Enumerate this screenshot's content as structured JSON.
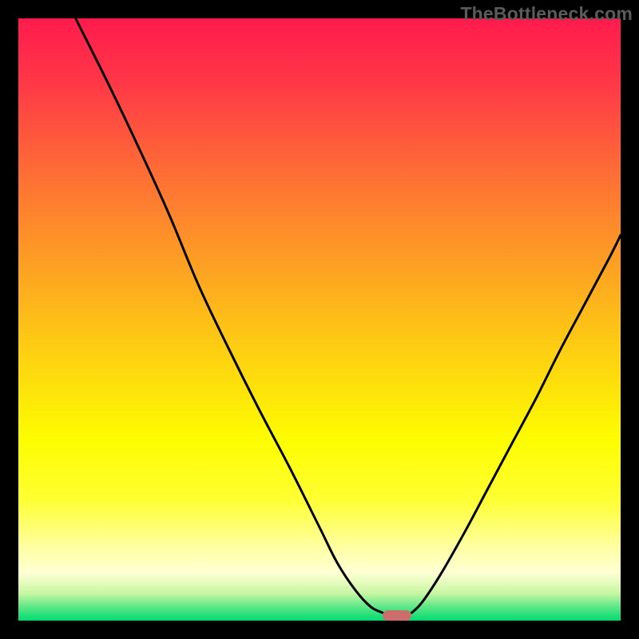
{
  "watermark": "TheBottleneck.com",
  "colors": {
    "frame": "#000000",
    "watermark": "#5b5b5b",
    "curve": "#000000",
    "marker": "#cb6e6c",
    "gradient_stops": [
      {
        "offset": 0.0,
        "color": "#ff1b4d"
      },
      {
        "offset": 0.1,
        "color": "#ff3548"
      },
      {
        "offset": 0.25,
        "color": "#fe6b36"
      },
      {
        "offset": 0.4,
        "color": "#fd9d24"
      },
      {
        "offset": 0.55,
        "color": "#fdce12"
      },
      {
        "offset": 0.7,
        "color": "#fdfd00"
      },
      {
        "offset": 0.8,
        "color": "#feff33"
      },
      {
        "offset": 0.88,
        "color": "#ffffa5"
      },
      {
        "offset": 0.92,
        "color": "#ffffd4"
      },
      {
        "offset": 0.955,
        "color": "#c7f6a2"
      },
      {
        "offset": 0.975,
        "color": "#66e889"
      },
      {
        "offset": 1.0,
        "color": "#00db71"
      }
    ]
  },
  "chart_data": {
    "type": "line",
    "title": "",
    "xlabel": "",
    "ylabel": "",
    "xlim": [
      0,
      100
    ],
    "ylim": [
      0,
      100
    ],
    "grid": false,
    "legend": false,
    "series": [
      {
        "name": "left-branch",
        "x": [
          9.5,
          15,
          20,
          25,
          30,
          35,
          40,
          45,
          50,
          53,
          56,
          58.5,
          60.5
        ],
        "y": [
          100,
          89,
          78.5,
          67.5,
          55.5,
          45,
          35,
          25.5,
          15.5,
          9.5,
          5,
          2.3,
          1.3
        ]
      },
      {
        "name": "right-branch",
        "x": [
          65.3,
          67,
          70,
          74,
          78,
          82,
          86,
          90,
          94,
          98,
          100
        ],
        "y": [
          1.3,
          3,
          7.5,
          14.5,
          22,
          29.5,
          37,
          45,
          52.5,
          60,
          64
        ]
      }
    ],
    "annotations": [
      {
        "name": "optimal-marker",
        "shape": "pill",
        "x_center": 62.9,
        "y": 0.9,
        "width_pct": 4.8,
        "height_pct": 1.7
      }
    ]
  }
}
